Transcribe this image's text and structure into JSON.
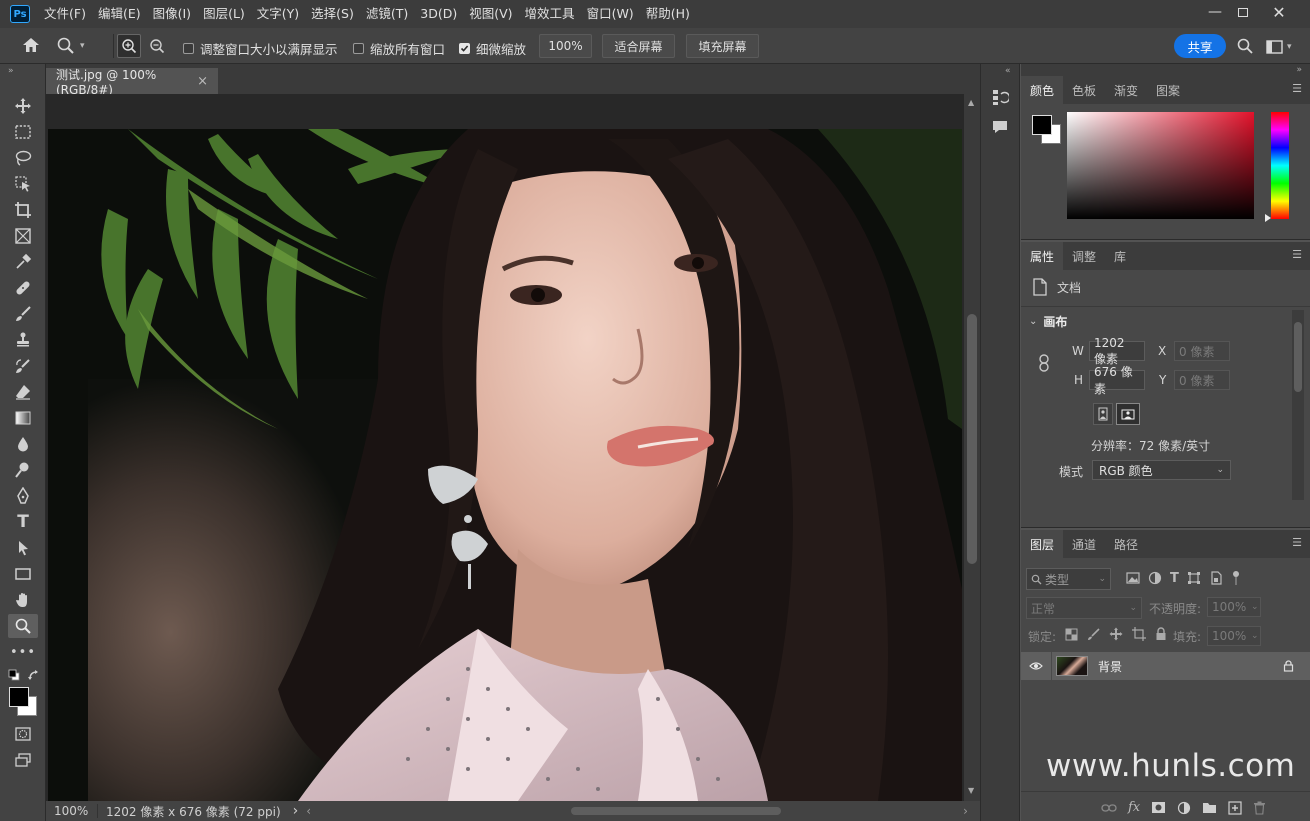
{
  "menu": {
    "logo": "Ps",
    "items": [
      "文件(F)",
      "编辑(E)",
      "图像(I)",
      "图层(L)",
      "文字(Y)",
      "选择(S)",
      "滤镜(T)",
      "3D(D)",
      "视图(V)",
      "增效工具",
      "窗口(W)",
      "帮助(H)"
    ]
  },
  "options": {
    "resize_windows": "调整窗口大小以满屏显示",
    "zoom_all": "缩放所有窗口",
    "scrubby_zoom": "细微缩放",
    "zoom_value": "100%",
    "fit_screen": "适合屏幕",
    "fill_screen": "填充屏幕",
    "share": "共享"
  },
  "document": {
    "tab_title": "测试.jpg @ 100%(RGB/8#)",
    "tab_close": "×"
  },
  "status": {
    "zoom": "100%",
    "info": "1202 像素 x 676 像素 (72 ppi)",
    "arrow": "›"
  },
  "color_panel": {
    "tabs": [
      "颜色",
      "色板",
      "渐变",
      "图案"
    ]
  },
  "properties_panel": {
    "tabs": [
      "属性",
      "调整",
      "库"
    ],
    "doc_label": "文档",
    "section": "画布",
    "w_label": "W",
    "w_value": "1202 像素",
    "h_label": "H",
    "h_value": "676 像素",
    "x_label": "X",
    "x_value": "0 像素",
    "y_label": "Y",
    "y_value": "0 像素",
    "resolution": "分辨率：72 像素/英寸",
    "mode_label": "模式",
    "mode_value": "RGB 颜色"
  },
  "layers_panel": {
    "tabs": [
      "图层",
      "通道",
      "路径"
    ],
    "search_placeholder": "类型",
    "blend_mode": "正常",
    "opacity_label": "不透明度:",
    "opacity_value": "100%",
    "lock_label": "锁定:",
    "fill_label": "填充:",
    "fill_value": "100%",
    "layer_name": "背景",
    "footer_fx": "fx"
  },
  "watermark": "www.hunls.com",
  "colors": {
    "accent": "#1473e6",
    "foreground": "#000000",
    "background": "#ffffff"
  }
}
